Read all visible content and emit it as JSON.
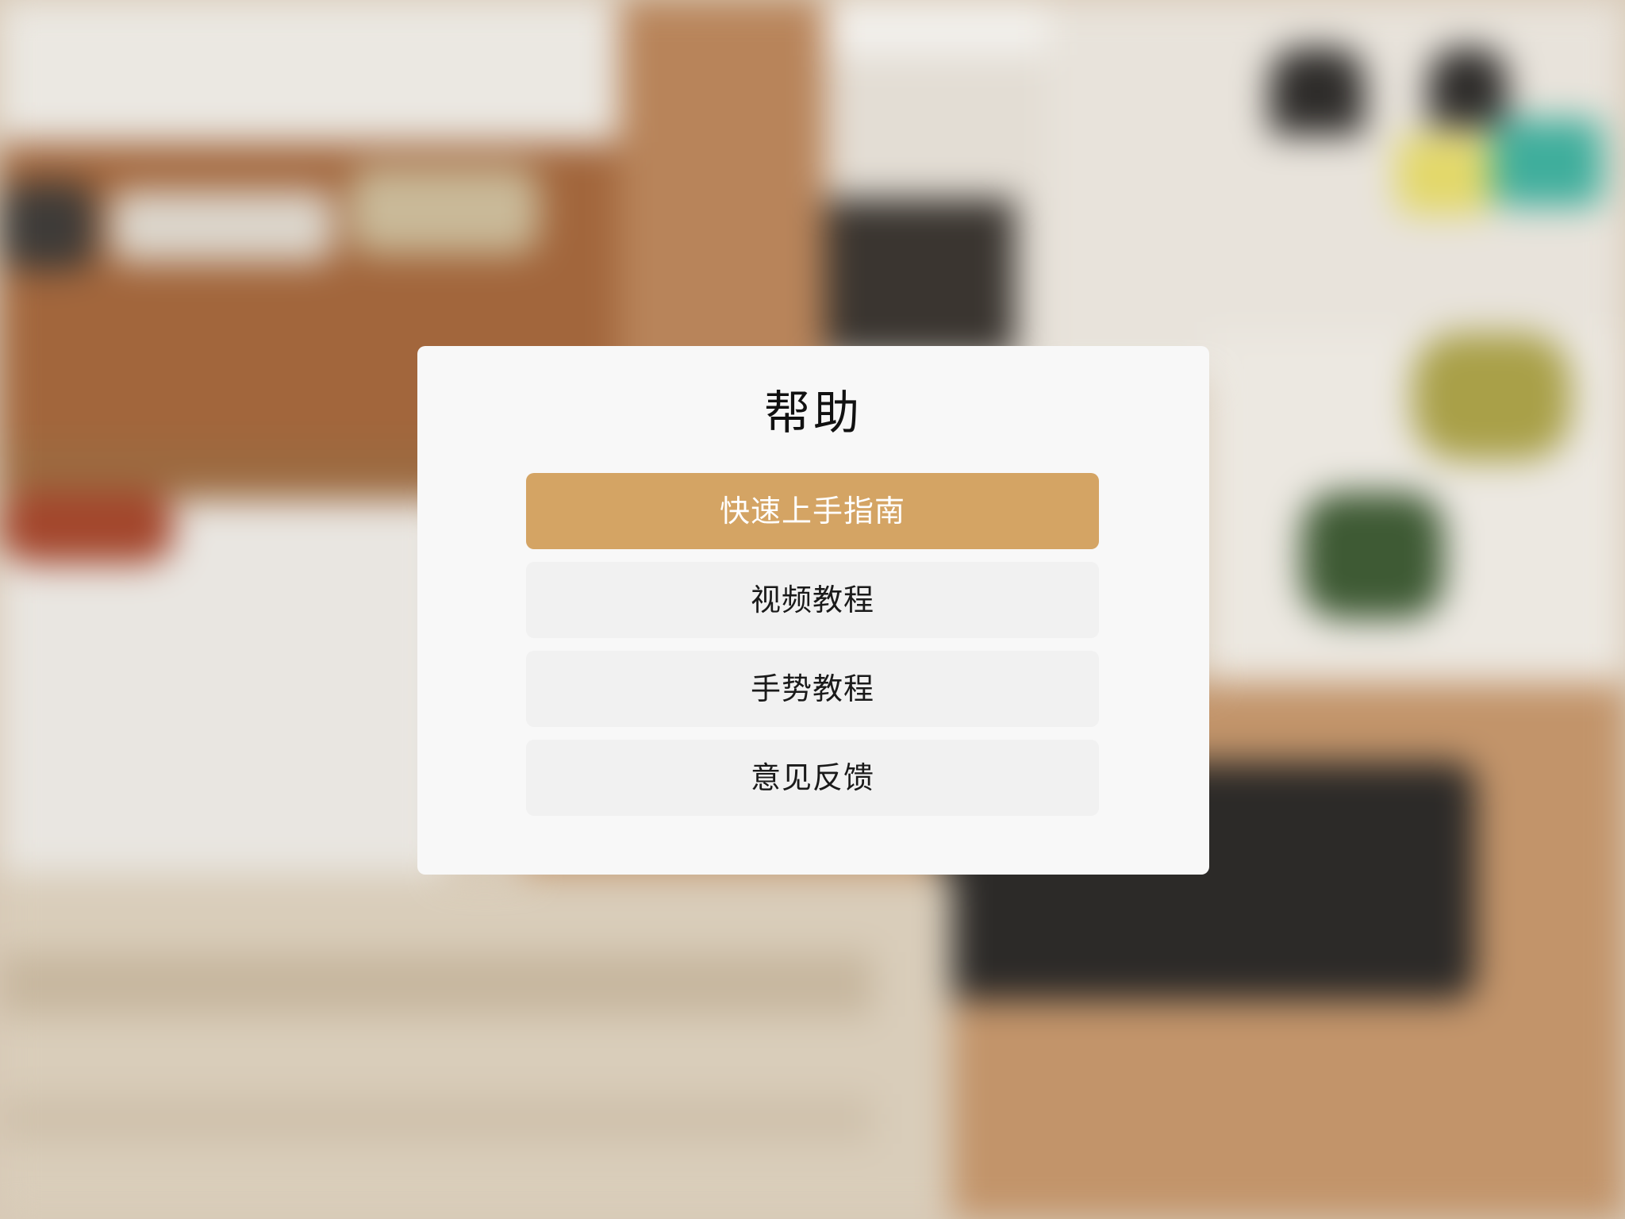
{
  "dialog": {
    "title": "帮助",
    "items": [
      {
        "label": "快速上手指南",
        "selected": true
      },
      {
        "label": "视频教程",
        "selected": false
      },
      {
        "label": "手势教程",
        "selected": false
      },
      {
        "label": "意见反馈",
        "selected": false
      }
    ]
  },
  "colors": {
    "accent": "#d4a464",
    "button_bg": "#f1f1f1",
    "dialog_bg": "#f8f8f8"
  }
}
